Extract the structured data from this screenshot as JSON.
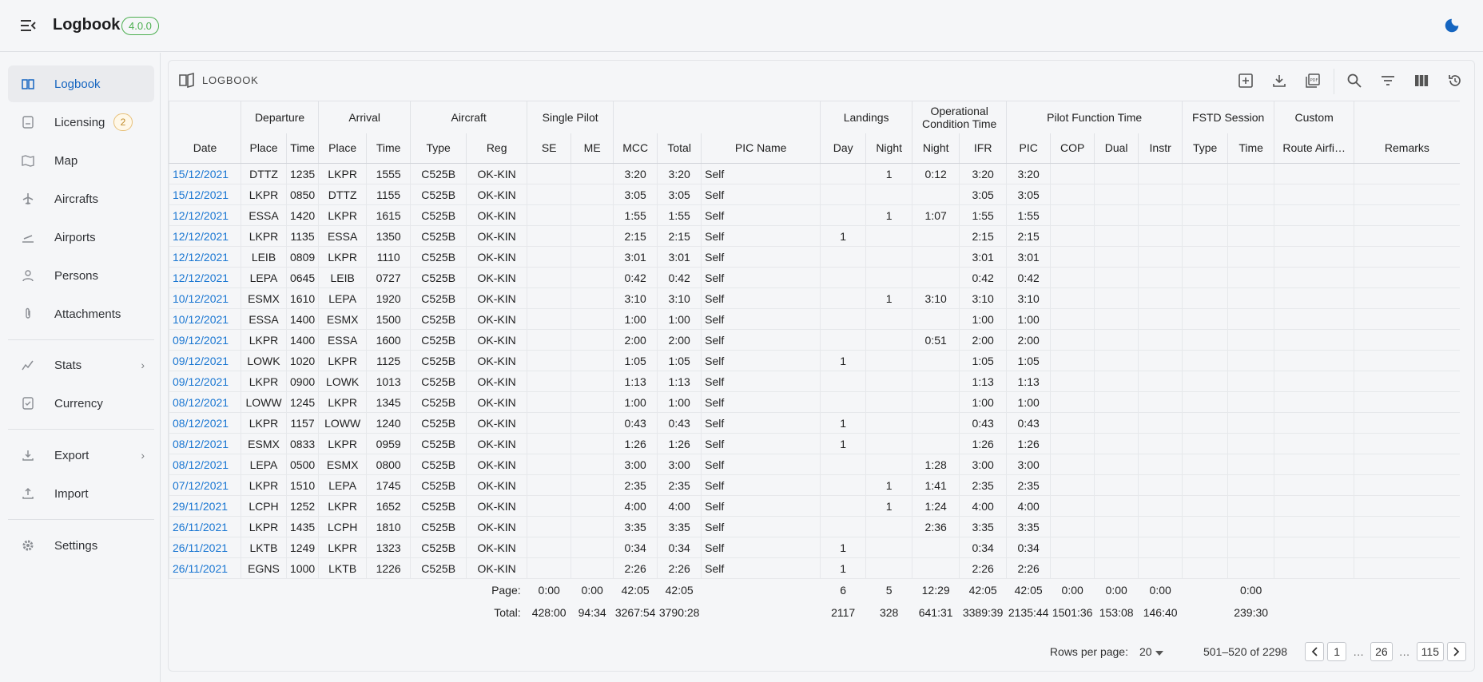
{
  "app": {
    "title": "Logbook",
    "version": "4.0.0"
  },
  "sidebar": {
    "items": [
      {
        "label": "Logbook",
        "icon": "logbook-icon"
      },
      {
        "label": "Licensing",
        "badge": "2",
        "icon": "licensing-icon"
      },
      {
        "label": "Map",
        "icon": "map-icon"
      },
      {
        "label": "Aircrafts",
        "icon": "aircraft-icon"
      },
      {
        "label": "Airports",
        "icon": "airport-icon"
      },
      {
        "label": "Persons",
        "icon": "person-icon"
      },
      {
        "label": "Attachments",
        "icon": "attachment-icon"
      },
      {
        "label": "Stats",
        "icon": "stats-icon"
      },
      {
        "label": "Currency",
        "icon": "currency-icon"
      },
      {
        "label": "Export",
        "icon": "export-icon"
      },
      {
        "label": "Import",
        "icon": "import-icon"
      },
      {
        "label": "Settings",
        "icon": "settings-icon"
      }
    ]
  },
  "card": {
    "title": "LOGBOOK"
  },
  "headers": {
    "groups": [
      "Departure",
      "Arrival",
      "Aircraft",
      "Single Pilot",
      "Landings",
      "Operational Condition Time",
      "Pilot Function Time",
      "FSTD Session",
      "Custom"
    ],
    "cols": [
      "Date",
      "Place",
      "Time",
      "Place",
      "Time",
      "Type",
      "Reg",
      "SE",
      "ME",
      "MCC",
      "Total",
      "PIC Name",
      "Day",
      "Night",
      "Night",
      "IFR",
      "PIC",
      "COP",
      "Dual",
      "Instr",
      "Type",
      "Time",
      "Route Airfi…",
      "Remarks"
    ]
  },
  "rows": [
    [
      "15/12/2021",
      "DTTZ",
      "1235",
      "LKPR",
      "1555",
      "C525B",
      "OK-KIN",
      "",
      "",
      "3:20",
      "3:20",
      "Self",
      "",
      "1",
      "0:12",
      "3:20",
      "3:20",
      "",
      "",
      "",
      "",
      "",
      "",
      ""
    ],
    [
      "15/12/2021",
      "LKPR",
      "0850",
      "DTTZ",
      "1155",
      "C525B",
      "OK-KIN",
      "",
      "",
      "3:05",
      "3:05",
      "Self",
      "",
      "",
      "",
      "3:05",
      "3:05",
      "",
      "",
      "",
      "",
      "",
      "",
      ""
    ],
    [
      "12/12/2021",
      "ESSA",
      "1420",
      "LKPR",
      "1615",
      "C525B",
      "OK-KIN",
      "",
      "",
      "1:55",
      "1:55",
      "Self",
      "",
      "1",
      "1:07",
      "1:55",
      "1:55",
      "",
      "",
      "",
      "",
      "",
      "",
      ""
    ],
    [
      "12/12/2021",
      "LKPR",
      "1135",
      "ESSA",
      "1350",
      "C525B",
      "OK-KIN",
      "",
      "",
      "2:15",
      "2:15",
      "Self",
      "1",
      "",
      "",
      "2:15",
      "2:15",
      "",
      "",
      "",
      "",
      "",
      "",
      ""
    ],
    [
      "12/12/2021",
      "LEIB",
      "0809",
      "LKPR",
      "1110",
      "C525B",
      "OK-KIN",
      "",
      "",
      "3:01",
      "3:01",
      "Self",
      "",
      "",
      "",
      "3:01",
      "3:01",
      "",
      "",
      "",
      "",
      "",
      "",
      ""
    ],
    [
      "12/12/2021",
      "LEPA",
      "0645",
      "LEIB",
      "0727",
      "C525B",
      "OK-KIN",
      "",
      "",
      "0:42",
      "0:42",
      "Self",
      "",
      "",
      "",
      "0:42",
      "0:42",
      "",
      "",
      "",
      "",
      "",
      "",
      ""
    ],
    [
      "10/12/2021",
      "ESMX",
      "1610",
      "LEPA",
      "1920",
      "C525B",
      "OK-KIN",
      "",
      "",
      "3:10",
      "3:10",
      "Self",
      "",
      "1",
      "3:10",
      "3:10",
      "3:10",
      "",
      "",
      "",
      "",
      "",
      "",
      ""
    ],
    [
      "10/12/2021",
      "ESSA",
      "1400",
      "ESMX",
      "1500",
      "C525B",
      "OK-KIN",
      "",
      "",
      "1:00",
      "1:00",
      "Self",
      "",
      "",
      "",
      "1:00",
      "1:00",
      "",
      "",
      "",
      "",
      "",
      "",
      ""
    ],
    [
      "09/12/2021",
      "LKPR",
      "1400",
      "ESSA",
      "1600",
      "C525B",
      "OK-KIN",
      "",
      "",
      "2:00",
      "2:00",
      "Self",
      "",
      "",
      "0:51",
      "2:00",
      "2:00",
      "",
      "",
      "",
      "",
      "",
      "",
      ""
    ],
    [
      "09/12/2021",
      "LOWK",
      "1020",
      "LKPR",
      "1125",
      "C525B",
      "OK-KIN",
      "",
      "",
      "1:05",
      "1:05",
      "Self",
      "1",
      "",
      "",
      "1:05",
      "1:05",
      "",
      "",
      "",
      "",
      "",
      "",
      ""
    ],
    [
      "09/12/2021",
      "LKPR",
      "0900",
      "LOWK",
      "1013",
      "C525B",
      "OK-KIN",
      "",
      "",
      "1:13",
      "1:13",
      "Self",
      "",
      "",
      "",
      "1:13",
      "1:13",
      "",
      "",
      "",
      "",
      "",
      "",
      ""
    ],
    [
      "08/12/2021",
      "LOWW",
      "1245",
      "LKPR",
      "1345",
      "C525B",
      "OK-KIN",
      "",
      "",
      "1:00",
      "1:00",
      "Self",
      "",
      "",
      "",
      "1:00",
      "1:00",
      "",
      "",
      "",
      "",
      "",
      "",
      ""
    ],
    [
      "08/12/2021",
      "LKPR",
      "1157",
      "LOWW",
      "1240",
      "C525B",
      "OK-KIN",
      "",
      "",
      "0:43",
      "0:43",
      "Self",
      "1",
      "",
      "",
      "0:43",
      "0:43",
      "",
      "",
      "",
      "",
      "",
      "",
      ""
    ],
    [
      "08/12/2021",
      "ESMX",
      "0833",
      "LKPR",
      "0959",
      "C525B",
      "OK-KIN",
      "",
      "",
      "1:26",
      "1:26",
      "Self",
      "1",
      "",
      "",
      "1:26",
      "1:26",
      "",
      "",
      "",
      "",
      "",
      "",
      ""
    ],
    [
      "08/12/2021",
      "LEPA",
      "0500",
      "ESMX",
      "0800",
      "C525B",
      "OK-KIN",
      "",
      "",
      "3:00",
      "3:00",
      "Self",
      "",
      "",
      "1:28",
      "3:00",
      "3:00",
      "",
      "",
      "",
      "",
      "",
      "",
      ""
    ],
    [
      "07/12/2021",
      "LKPR",
      "1510",
      "LEPA",
      "1745",
      "C525B",
      "OK-KIN",
      "",
      "",
      "2:35",
      "2:35",
      "Self",
      "",
      "1",
      "1:41",
      "2:35",
      "2:35",
      "",
      "",
      "",
      "",
      "",
      "",
      ""
    ],
    [
      "29/11/2021",
      "LCPH",
      "1252",
      "LKPR",
      "1652",
      "C525B",
      "OK-KIN",
      "",
      "",
      "4:00",
      "4:00",
      "Self",
      "",
      "1",
      "1:24",
      "4:00",
      "4:00",
      "",
      "",
      "",
      "",
      "",
      "",
      ""
    ],
    [
      "26/11/2021",
      "LKPR",
      "1435",
      "LCPH",
      "1810",
      "C525B",
      "OK-KIN",
      "",
      "",
      "3:35",
      "3:35",
      "Self",
      "",
      "",
      "2:36",
      "3:35",
      "3:35",
      "",
      "",
      "",
      "",
      "",
      "",
      ""
    ],
    [
      "26/11/2021",
      "LKTB",
      "1249",
      "LKPR",
      "1323",
      "C525B",
      "OK-KIN",
      "",
      "",
      "0:34",
      "0:34",
      "Self",
      "1",
      "",
      "",
      "0:34",
      "0:34",
      "",
      "",
      "",
      "",
      "",
      "",
      ""
    ],
    [
      "26/11/2021",
      "EGNS",
      "1000",
      "LKTB",
      "1226",
      "C525B",
      "OK-KIN",
      "",
      "",
      "2:26",
      "2:26",
      "Self",
      "1",
      "",
      "",
      "2:26",
      "2:26",
      "",
      "",
      "",
      "",
      "",
      "",
      ""
    ]
  ],
  "totals": {
    "page": {
      "label": "Page:",
      "se": "0:00",
      "me": "0:00",
      "mcc": "42:05",
      "total": "42:05",
      "day": "6",
      "night": "5",
      "oc_night": "12:29",
      "ifr": "42:05",
      "pic": "42:05",
      "cop": "0:00",
      "dual": "0:00",
      "instr": "0:00",
      "fstd_time": "0:00"
    },
    "total": {
      "label": "Total:",
      "se": "428:00",
      "me": "94:34",
      "mcc": "3267:54",
      "total": "3790:28",
      "day": "2117",
      "night": "328",
      "oc_night": "641:31",
      "ifr": "3389:39",
      "pic": "2135:44",
      "cop": "1501:36",
      "dual": "153:08",
      "instr": "146:40",
      "fstd_time": "239:30"
    }
  },
  "pagination": {
    "rows_per_page_label": "Rows per page:",
    "rows_per_page": "20",
    "range": "501–520 of 2298",
    "pages": [
      "1",
      "26",
      "115"
    ],
    "ellipsis": "…"
  }
}
